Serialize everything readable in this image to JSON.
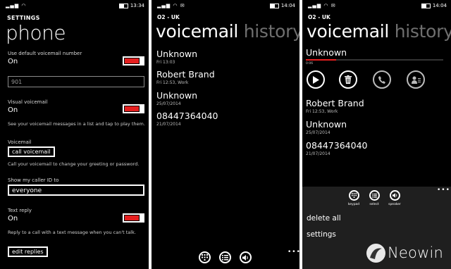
{
  "settings": {
    "status": {
      "time": "13:34"
    },
    "small_title": "SETTINGS",
    "title": "phone",
    "default_vm_label": "Use default voicemail number",
    "default_vm_value": "On",
    "vm_number": "901",
    "visual_vm_label": "Visual voicemail",
    "visual_vm_value": "On",
    "visual_vm_desc": "See your voicemail messages in a list and tap to play them.",
    "voicemail_label": "Voicemail",
    "call_voicemail_button": "call voicemail",
    "call_voicemail_desc": "Call your voicemail to change your greeting or password.",
    "caller_id_label": "Show my caller ID to",
    "caller_id_value": "everyone",
    "text_reply_label": "Text reply",
    "text_reply_value": "On",
    "text_reply_desc": "Reply to a call with a text message when you can't talk.",
    "edit_replies_button": "edit replies"
  },
  "voicemail_list": {
    "status": {
      "time": "14:04"
    },
    "carrier": "O2 - UK",
    "pivot_active": "voicemail",
    "pivot_others": "history sp",
    "items": [
      {
        "name": "Unknown",
        "detail": "Fri 13:03"
      },
      {
        "name": "Robert Brand",
        "detail": "Fri 12:53, Work"
      },
      {
        "name": "Unknown",
        "detail": "25/07/2014"
      },
      {
        "name": "08447364040",
        "detail": "21/07/2014"
      }
    ],
    "more": "•••"
  },
  "voicemail_detail": {
    "status": {
      "time": "14:04"
    },
    "carrier": "O2 - UK",
    "pivot_active": "voicemail",
    "pivot_others": "history sp",
    "selected_name": "Unknown",
    "elapsed": "0:06",
    "progress": 0.22,
    "items": [
      {
        "name": "Robert Brand",
        "detail": "Fri 12:53, Work"
      },
      {
        "name": "Unknown",
        "detail": "25/07/2014"
      },
      {
        "name": "08447364040",
        "detail": "21/07/2014"
      }
    ],
    "appbar_labels": {
      "keypad": "keypad",
      "select": "select",
      "speaker": "speaker"
    },
    "menu": {
      "delete_all": "delete all",
      "settings": "settings"
    },
    "more": "•••"
  },
  "watermark": {
    "text": "Neowin"
  },
  "icons": [
    "signal-icon",
    "wifi-icon",
    "battery-icon",
    "play-icon",
    "delete-icon",
    "call-icon",
    "contact-icon",
    "keypad-icon",
    "select-icon",
    "speaker-icon",
    "more-icon"
  ],
  "colors": {
    "accent": "#e51f1f",
    "background": "#000000",
    "menu_bg": "#1f1f1f"
  }
}
